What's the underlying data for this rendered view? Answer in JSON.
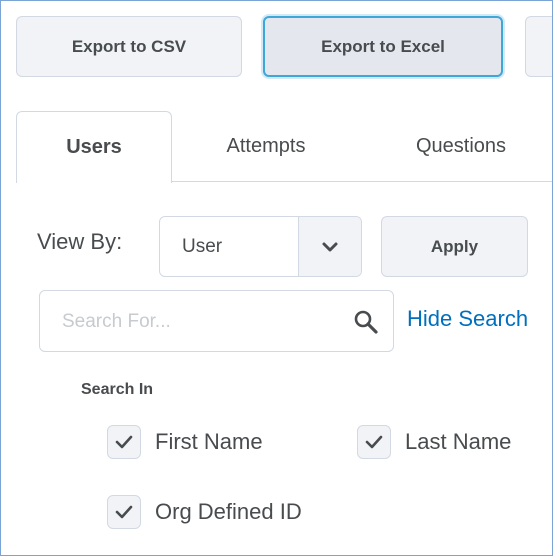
{
  "toolbar": {
    "export_csv_label": "Export to CSV",
    "export_excel_label": "Export to Excel"
  },
  "tabs": [
    {
      "label": "Users",
      "active": true
    },
    {
      "label": "Attempts",
      "active": false
    },
    {
      "label": "Questions",
      "active": false
    }
  ],
  "view_by": {
    "label": "View By:",
    "selected": "User",
    "apply_label": "Apply"
  },
  "search": {
    "placeholder": "Search For...",
    "hide_label": "Hide Search"
  },
  "search_in": {
    "label": "Search In",
    "options": [
      {
        "label": "First Name",
        "checked": true
      },
      {
        "label": "Last Name",
        "checked": true
      },
      {
        "label": "Org Defined ID",
        "checked": true
      }
    ]
  },
  "colors": {
    "link": "#006fbf",
    "focus_ring": "#3fa6d8",
    "text": "#494c4e",
    "border": "#d3d9e3"
  },
  "icons": {
    "search": "search-icon",
    "dropdown": "chevron-down-icon",
    "check": "check-icon"
  }
}
